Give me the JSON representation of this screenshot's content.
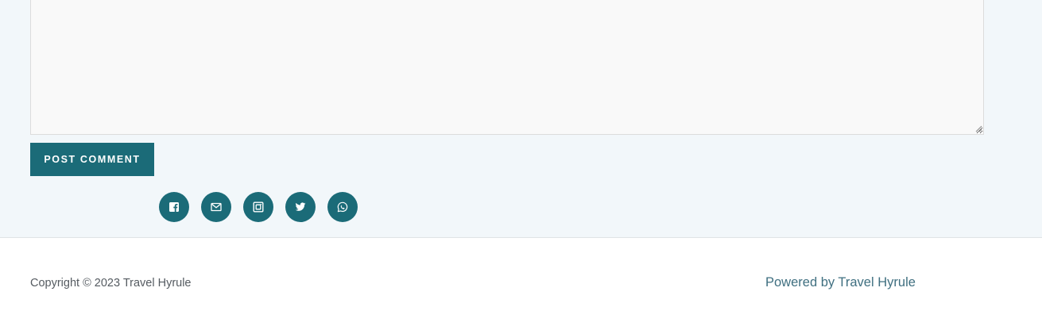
{
  "comment_form": {
    "textarea_value": "",
    "submit_label": "POST COMMENT"
  },
  "social_share": {
    "icons": [
      "facebook-icon",
      "email-icon",
      "instagram-icon",
      "twitter-icon",
      "whatsapp-icon"
    ],
    "button_color": "#1b6b78"
  },
  "footer": {
    "copyright": "Copyright © 2023 Travel Hyrule",
    "powered_prefix": "Powered by ",
    "powered_link": "Travel Hyrule"
  },
  "colors": {
    "accent": "#1b6b78",
    "section_bg": "#f2f7fa",
    "link": "#3f6f80"
  }
}
